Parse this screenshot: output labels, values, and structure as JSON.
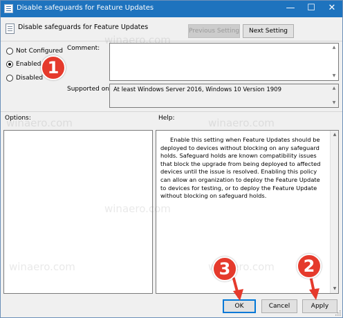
{
  "window": {
    "title": "Disable safeguards for Feature Updates",
    "controls": {
      "minimize": "—",
      "maximize": "☐",
      "close": "✕"
    }
  },
  "header": {
    "policy_name": "Disable safeguards for Feature Updates",
    "previous_setting_label": "Previous Setting",
    "next_setting_label": "Next Setting"
  },
  "state": {
    "options": [
      {
        "label": "Not Configured",
        "checked": false
      },
      {
        "label": "Enabled",
        "checked": true
      },
      {
        "label": "Disabled",
        "checked": false
      }
    ]
  },
  "comment": {
    "label": "Comment:",
    "value": ""
  },
  "supported": {
    "label": "Supported on:",
    "value": "At least Windows Server 2016, Windows 10 Version 1909"
  },
  "options_section": {
    "label": "Options:"
  },
  "help_section": {
    "label": "Help:",
    "text": "Enable this setting when Feature Updates should be deployed to devices without blocking on any safeguard holds. Safeguard holds are known compatibility issues that block the upgrade from being deployed to affected devices until the issue is resolved. Enabling this policy can allow an organization to deploy the Feature Update to devices for testing, or to deploy the Feature Update without blocking on safeguard holds."
  },
  "footer": {
    "ok_label": "OK",
    "cancel_label": "Cancel",
    "apply_label": "Apply"
  },
  "annotations": {
    "badge_1": "1",
    "badge_2": "2",
    "badge_3": "3",
    "color": "#e53a2c"
  },
  "watermark": "winaero.com",
  "colors": {
    "titlebar": "#1e73be",
    "window_bg": "#f0f0f0",
    "focus_border": "#0078d7"
  }
}
